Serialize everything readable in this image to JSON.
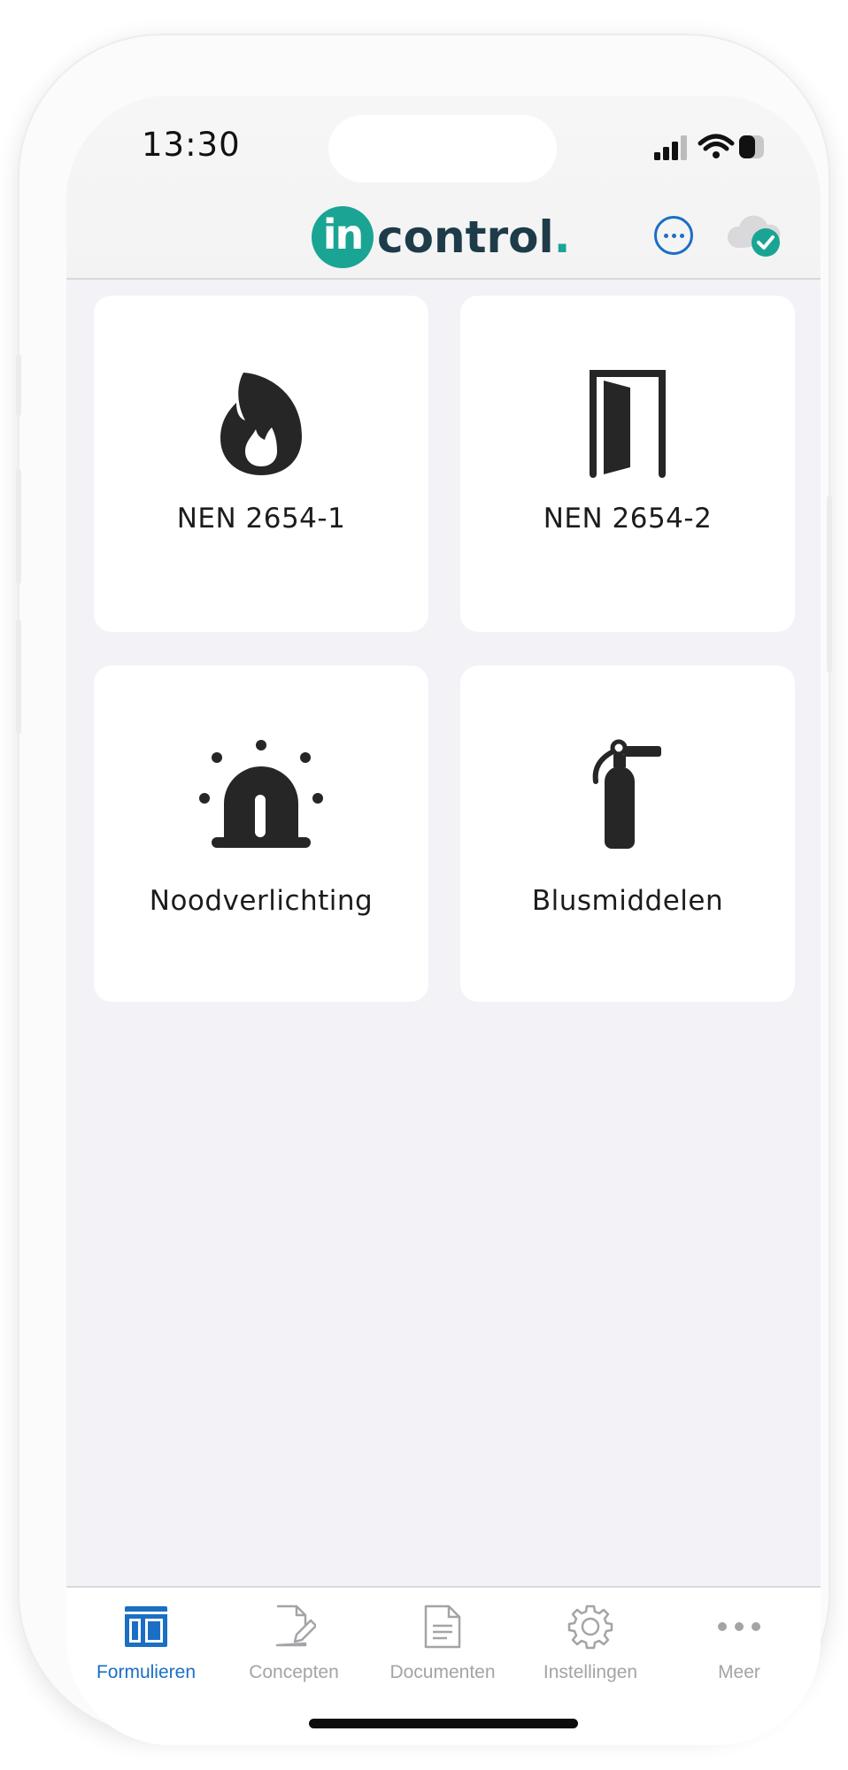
{
  "status_bar": {
    "time": "13:30"
  },
  "header": {
    "logo_mark": "in",
    "logo_text": "control",
    "logo_dot": ".",
    "brand_color": "#1aa493",
    "accent_color": "#1a6fc4"
  },
  "tiles": [
    {
      "label": "NEN 2654-1",
      "icon": "flame-icon"
    },
    {
      "label": "NEN 2654-2",
      "icon": "door-icon"
    },
    {
      "label": "Noodverlichting",
      "icon": "emergency-light-icon"
    },
    {
      "label": "Blusmiddelen",
      "icon": "fire-extinguisher-icon"
    }
  ],
  "tabbar": {
    "items": [
      {
        "label": "Formulieren",
        "icon": "forms-icon",
        "active": true
      },
      {
        "label": "Concepten",
        "icon": "draft-icon",
        "active": false
      },
      {
        "label": "Documenten",
        "icon": "document-icon",
        "active": false
      },
      {
        "label": "Instellingen",
        "icon": "gear-icon",
        "active": false
      },
      {
        "label": "Meer",
        "icon": "more-icon",
        "active": false
      }
    ]
  }
}
